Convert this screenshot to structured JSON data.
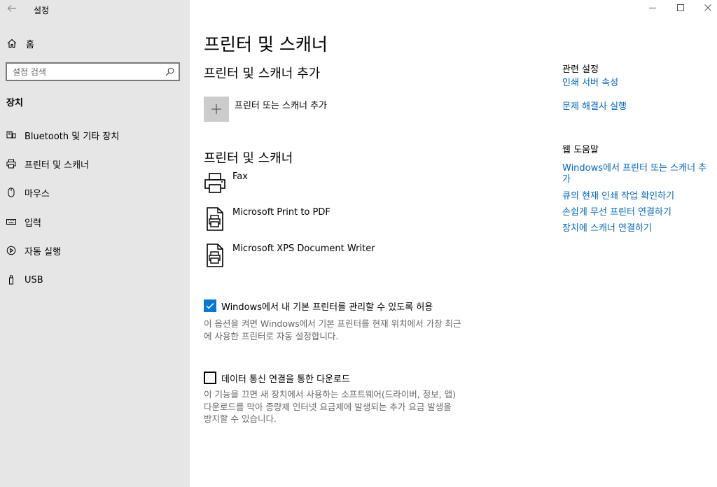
{
  "window": {
    "title": "설정",
    "back_icon": "back-arrow-icon",
    "controls": [
      "minimize-icon",
      "maximize-icon",
      "close-icon"
    ]
  },
  "sidebar": {
    "home_label": "홈",
    "search_placeholder": "설정 검색",
    "section_label": "장치",
    "items": [
      {
        "label": "Bluetooth 및 기타 장치",
        "icon": "bluetooth-devices-icon"
      },
      {
        "label": "프린터 및 스캐너",
        "icon": "printer-icon",
        "selected": true
      },
      {
        "label": "마우스",
        "icon": "mouse-icon"
      },
      {
        "label": "입력",
        "icon": "keyboard-icon"
      },
      {
        "label": "자동 실행",
        "icon": "autoplay-icon"
      },
      {
        "label": "USB",
        "icon": "usb-icon"
      }
    ]
  },
  "main": {
    "title": "프린터 및 스캐너",
    "add_section_title": "프린터 및 스캐너 추가",
    "add_button_label": "프린터 또는 스캐너 추가",
    "list_section_title": "프린터 및 스캐너",
    "printers": [
      {
        "name": "Fax",
        "icon": "fax-printer-icon"
      },
      {
        "name": "Microsoft Print to PDF",
        "icon": "document-printer-icon"
      },
      {
        "name": "Microsoft XPS Document Writer",
        "icon": "document-printer-icon"
      }
    ],
    "manage_default": {
      "checked": true,
      "label": "Windows에서 내 기본 프린터를 관리할 수 있도록 허용",
      "desc_line1": "이 옵션을 켜면 Windows에서 기본 프린터를 현재 위치에서 가장 최근",
      "desc_line2": "에 사용한 프린터로 자동 설정합니다."
    },
    "metered_download": {
      "checked": false,
      "label": "데이터 통신 연결을 통한 다운로드",
      "desc_line1": "이 기능을 끄면 새 장치에서 사용하는 소프트웨어(드라이버, 정보, 앱)",
      "desc_line2": "다운로드를 막아 종량제 인터넷 요금제에 발생되는 추가 요금 발생을",
      "desc_line3": "방지할 수 있습니다."
    }
  },
  "related": {
    "heading": "관련 설정",
    "links": [
      "인쇄 서버 속성",
      "문제 해결사 실행"
    ]
  },
  "help": {
    "heading": "웹 도움말",
    "links": [
      "Windows에서 프린터 또는 스캐너 추가",
      "큐의 현재 인쇄 작업 확인하기",
      "손쉽게 무선 프린터 연결하기",
      "장치에 스캐너 연결하기"
    ]
  },
  "colors": {
    "sidebar_bg": "#e6e6e6",
    "accent": "#0078d7",
    "link": "#0067c0"
  }
}
